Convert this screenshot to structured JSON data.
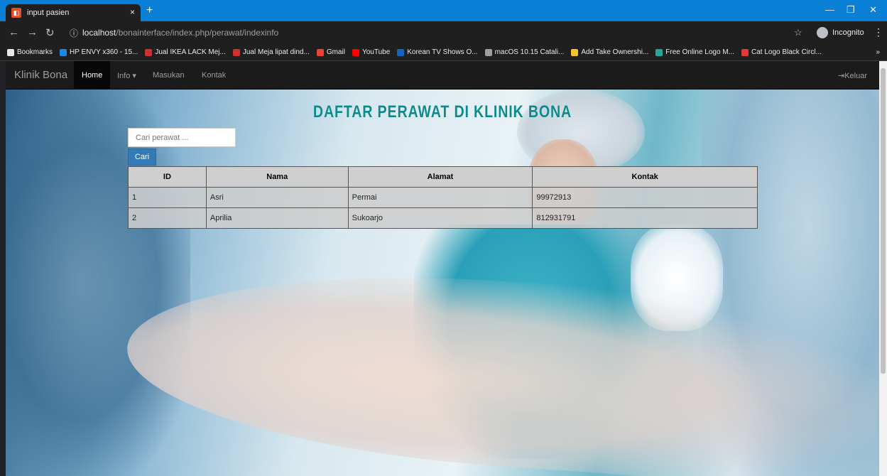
{
  "browser": {
    "tab_title": "input pasien",
    "tab_close": "×",
    "new_tab": "+",
    "url_host": "localhost",
    "url_path": "/bonainterface/index.php/perawat/indexinfo",
    "incognito_label": "Incognito",
    "bookmarks": [
      {
        "label": "Bookmarks",
        "color": "#e8eaed"
      },
      {
        "label": "HP ENVY x360 - 15...",
        "color": "#1e88e5"
      },
      {
        "label": "Jual IKEA LACK Mej...",
        "color": "#d32f2f"
      },
      {
        "label": "Jual Meja lipat dind...",
        "color": "#d32f2f"
      },
      {
        "label": "Gmail",
        "color": "#ea4335"
      },
      {
        "label": "YouTube",
        "color": "#ff0000"
      },
      {
        "label": "Korean TV Shows O...",
        "color": "#1565c0"
      },
      {
        "label": "macOS 10.15 Catali...",
        "color": "#9e9e9e"
      },
      {
        "label": "Add Take Ownershi...",
        "color": "#fbc02d"
      },
      {
        "label": "Free Online Logo M...",
        "color": "#26a69a"
      },
      {
        "label": "Cat Logo Black Circl...",
        "color": "#e53935"
      }
    ],
    "more_bookmarks": "»"
  },
  "navbar": {
    "brand": "Klinik Bona",
    "home": "Home",
    "info": "Info ▾",
    "masukan": "Masukan",
    "kontak": "Kontak",
    "logout": "Keluar"
  },
  "page": {
    "title": "DAFTAR PERAWAT DI KLINIK BONA",
    "search_placeholder": "Cari perawat ...",
    "search_button": "Cari"
  },
  "table": {
    "headers": [
      "ID",
      "Nama",
      "Alamat",
      "Kontak"
    ],
    "rows": [
      [
        "1",
        "Asri",
        "Permai",
        "99972913"
      ],
      [
        "2",
        "Aprilia",
        "Sukoarjo",
        "812931791"
      ]
    ]
  },
  "colors": {
    "title": "#0f8a8c",
    "primary_button": "#337ab7",
    "navbar": "#1b1b1b"
  }
}
